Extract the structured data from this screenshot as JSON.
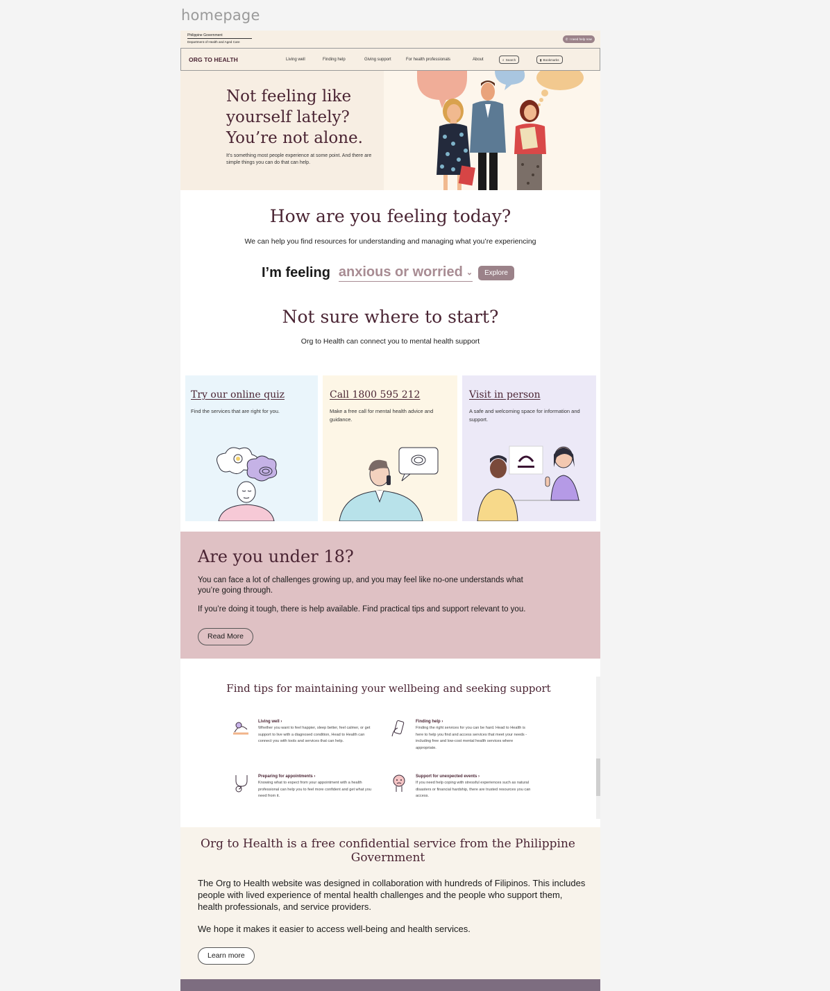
{
  "canvas_label": "homepage",
  "gov": {
    "line1": "Philippine Government",
    "line2": "Department of Health and Aged Care",
    "help_button": "I need help now"
  },
  "nav": {
    "brand": "ORG TO HEALTH",
    "items": [
      "Living well",
      "Finding help",
      "Giving support",
      "For health professionals",
      "About"
    ],
    "search": "Search",
    "bookmarks": "Bookmarks"
  },
  "hero": {
    "title": "Not feeling like yourself lately? You’re not alone.",
    "subtitle": "It’s something most people experience at some point. And there are simple things you can do that can help."
  },
  "feeling": {
    "title": "How are you feeling today?",
    "subtitle": "We can help you find resources for understanding and managing what you’re experiencing",
    "prefix": "I’m feeling",
    "selected": "anxious or worried",
    "explore": "Explore"
  },
  "start": {
    "title": "Not sure where to start?",
    "subtitle": "Org to Health can connect you to mental health support"
  },
  "cards": [
    {
      "title": "Try our online quiz",
      "desc": "Find the services that are right for you.",
      "bg": "#eaf5fb"
    },
    {
      "title": "Call 1800 595 212",
      "desc": "Make a free call for mental health advice and guidance.",
      "bg": "#fdf6e6"
    },
    {
      "title": "Visit in person",
      "desc": "A safe and welcoming space for information and support.",
      "bg": "#ece9f7"
    }
  ],
  "under18": {
    "title": "Are you under 18?",
    "p1": "You can face a lot of challenges growing up, and you may feel like no-one understands what you’re going through.",
    "p2": "If you’re doing it tough, there is help available. Find practical tips and support relevant to you.",
    "button": "Read More"
  },
  "tips": {
    "title": "Find tips for maintaining your wellbeing and seeking support",
    "items": [
      {
        "title": "Living well",
        "body": "Whether you want to feel happier, sleep better, feel calmer, or get support to live with a diagnosed condition, Head to Health can connect you with tools and services that can help.",
        "icon": "person-relaxing-icon"
      },
      {
        "title": "Finding help",
        "body": "Finding the right services for you can be hard. Head to Health is here to help you find and access services that meet your needs - including free and low-cost mental health services where appropriate.",
        "icon": "phone-hand-icon"
      },
      {
        "title": "Preparing for appointments",
        "body": "Knowing what to expect from your appointment with a health professional can help you to feel more confident and get what you need from it.",
        "icon": "stethoscope-icon"
      },
      {
        "title": "Support for unexpected events",
        "body": "If you need help coping with stressful experiences such as natural disasters or financial hardship, there are trusted resources you can access.",
        "icon": "worried-face-icon"
      }
    ],
    "arrow": "›"
  },
  "free": {
    "title": "Org to Health is a free confidential service from the Philippine Government",
    "p1": "The Org to Health website was designed in collaboration with hundreds of Filipinos. This includes people with lived experience of mental health challenges and the people who support them, health professionals, and service providers.",
    "p2": "We hope it makes it easier to access well-being and health services.",
    "button": "Learn more"
  },
  "colors": {
    "brand": "#4a2433",
    "accent": "#9b8289",
    "under18_bg": "#dfc1c4",
    "footer": "#7d6d80"
  }
}
